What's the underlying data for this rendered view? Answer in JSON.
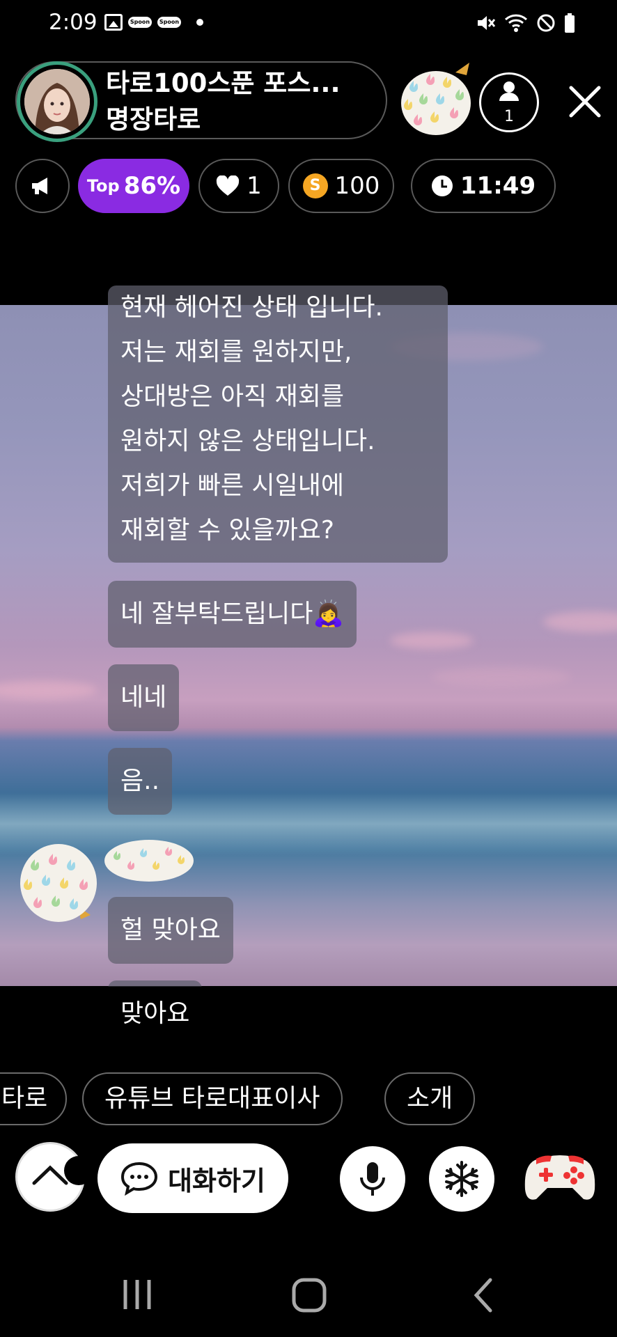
{
  "status_bar": {
    "time": "2:09",
    "spoon_badge_1": "Spoon",
    "spoon_badge_2": "Spoon"
  },
  "header": {
    "host_title_line1": "타로100스푼 포스...",
    "host_title_line2": "명장타로",
    "listener_count": "1"
  },
  "stats": {
    "top_prefix": "Top",
    "top_value": "86%",
    "likes": "1",
    "coin_symbol": "S",
    "spoons": "100",
    "timer": "11:49"
  },
  "chat": {
    "messages": [
      "현재 헤어진 상태 입니다.\n저는 재회를 원하지만,\n상대방은 아직 재회를\n원하지 않은 상태입니다.\n저희가 빠른 시일내에\n재회할 수 있을까요?",
      "네 잘부탁드립니다🙇‍♀️",
      "네네",
      "음..",
      "헐 맞아요",
      "맞아요"
    ]
  },
  "suggestions": [
    "타로",
    "유튜브 타로대표이사",
    "소개"
  ],
  "bottom_bar": {
    "chat_button_label": "대화하기"
  },
  "colors": {
    "top_chip": "#8a2be2",
    "avatar_ring": "#3aa07e",
    "coin": "#f5a623",
    "chip_border": "#5a5a5a",
    "bubble": "rgba(95,95,110,0.72)"
  },
  "icons": {
    "announce": "megaphone-icon",
    "like": "heart-icon",
    "timer": "clock-icon",
    "listener": "person-icon",
    "close": "close-icon",
    "expand": "chevron-up-icon",
    "chat": "chat-bubble-icon",
    "mic": "microphone-icon",
    "freeze": "snowflake-icon",
    "game": "gamepad-icon"
  }
}
